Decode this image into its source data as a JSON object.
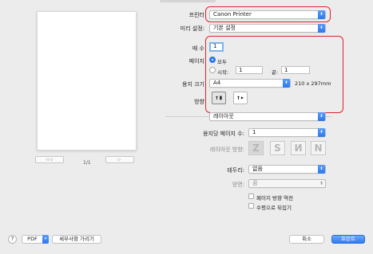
{
  "preview": {
    "page_counter": "1/1",
    "first_btn": "◁◁",
    "prev_btn": "◁",
    "next_btn": "▷",
    "last_btn": "▷▷"
  },
  "printer": {
    "label": "프린터",
    "value": "Canon Printer"
  },
  "presets": {
    "label": "미리 설정:",
    "value": "기본 설정"
  },
  "copies": {
    "label": "매 수",
    "value": "1"
  },
  "pages": {
    "label": "페이지",
    "all_label": "모두",
    "from_label": "시작:",
    "from_value": "1",
    "to_label": "끝:",
    "to_value": "1"
  },
  "paper_size": {
    "label": "용지 크기",
    "value": "A4",
    "dims": "210 x 297mm"
  },
  "orientation": {
    "label": "방향",
    "portrait": "↑▮",
    "landscape": "↑▸"
  },
  "section": {
    "value": "레이아웃"
  },
  "pages_per_sheet": {
    "label": "용지당 페이지 수:",
    "value": "1"
  },
  "layout_direction": {
    "label": "레이아웃 방향:",
    "tiles": [
      "Z",
      "S",
      "И",
      "N"
    ]
  },
  "border": {
    "label": "테두리:",
    "value": "없음"
  },
  "two_sided": {
    "label": "양면:",
    "value": "끔"
  },
  "checkboxes": {
    "reverse_orientation": "페이지 방향 역전",
    "flip_horizontal": "수평으로 뒤집기"
  },
  "footer": {
    "help": "?",
    "pdf": "PDF",
    "hide_details": "세부사항 가리기",
    "cancel": "취소",
    "print": "프린트"
  },
  "colors": {
    "accent": "#2b78ee",
    "highlight": "#e0222b"
  }
}
